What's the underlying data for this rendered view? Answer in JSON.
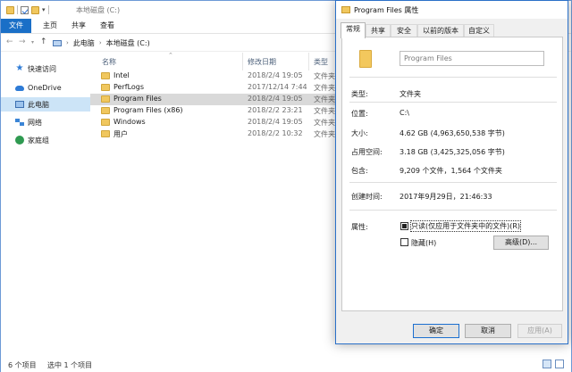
{
  "explorer": {
    "window_title": "本地磁盘 (C:)",
    "ribbon_tabs": [
      "文件",
      "主页",
      "共享",
      "查看"
    ],
    "breadcrumb": [
      "此电脑",
      "本地磁盘 (C:)"
    ],
    "columns": {
      "name": "名称",
      "date": "修改日期",
      "type": "类型"
    },
    "sidebar": [
      {
        "label": "快速访问",
        "icon": "star-icon"
      },
      {
        "label": "OneDrive",
        "icon": "cloud-icon"
      },
      {
        "label": "此电脑",
        "icon": "pc-icon"
      },
      {
        "label": "网络",
        "icon": "network-icon"
      },
      {
        "label": "家庭组",
        "icon": "homegroup-icon"
      }
    ],
    "files": [
      {
        "name": "Intel",
        "date": "2018/2/4 19:05",
        "type": "文件夹"
      },
      {
        "name": "PerfLogs",
        "date": "2017/12/14 7:44",
        "type": "文件夹"
      },
      {
        "name": "Program Files",
        "date": "2018/2/4 19:05",
        "type": "文件夹"
      },
      {
        "name": "Program Files (x86)",
        "date": "2018/2/2 23:21",
        "type": "文件夹"
      },
      {
        "name": "Windows",
        "date": "2018/2/4 19:05",
        "type": "文件夹"
      },
      {
        "name": "用户",
        "date": "2018/2/2 10:32",
        "type": "文件夹"
      }
    ],
    "status": {
      "count": "6 个项目",
      "selected": "选中 1 个项目"
    }
  },
  "props": {
    "title": "Program Files 属性",
    "tabs": [
      "常规",
      "共享",
      "安全",
      "以前的版本",
      "自定义"
    ],
    "folder_name": "Program Files",
    "rows": [
      {
        "label": "类型:",
        "value": "文件夹"
      },
      {
        "label": "位置:",
        "value": "C:\\"
      },
      {
        "label": "大小:",
        "value": "4.62 GB (4,963,650,538 字节)"
      },
      {
        "label": "占用空间:",
        "value": "3.18 GB (3,425,325,056 字节)"
      },
      {
        "label": "包含:",
        "value": "9,209 个文件，1,564 个文件夹"
      },
      {
        "label": "创建时间:",
        "value": "2017年9月29日，21:46:33"
      }
    ],
    "attributes_label": "属性:",
    "readonly_label": "只读(仅应用于文件夹中的文件)(R)",
    "hidden_label": "隐藏(H)",
    "advanced_button": "高级(D)...",
    "buttons": {
      "ok": "确定",
      "cancel": "取消",
      "apply": "应用(A)"
    }
  }
}
